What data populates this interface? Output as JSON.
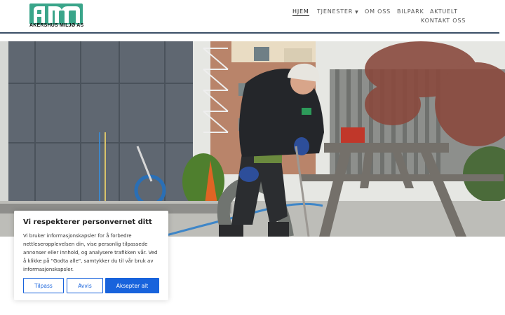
{
  "brand": {
    "logo_letters": "AM",
    "caption": "AKERSHUS MILJØ AS",
    "color": "#3aa58a"
  },
  "nav": {
    "items": [
      {
        "label": "HJEM",
        "active": true
      },
      {
        "label": "TJENESTER",
        "has_dropdown": true
      },
      {
        "label": "OM OSS"
      },
      {
        "label": "BILPARK"
      },
      {
        "label": "AKTUELT"
      },
      {
        "label": "KONTAKT OSS"
      }
    ],
    "caret_icon": "chevron-down-icon"
  },
  "hero": {
    "scene": "worker-with-suction-hose"
  },
  "consent": {
    "title": "Vi respekterer personvernet ditt",
    "text": "Vi bruker informasjonskapsler for å forbedre nettleseropplevelsen din, vise personlig tilpassede annonser eller innhold, og analysere trafikken vår. Ved å klikke på \"Godta alle\", samtykker du til vår bruk av informasjonskapsler.",
    "customize_label": "Tilpass",
    "reject_label": "Avvis",
    "accept_label": "Aksepter alt",
    "accent": "#1863dc"
  }
}
